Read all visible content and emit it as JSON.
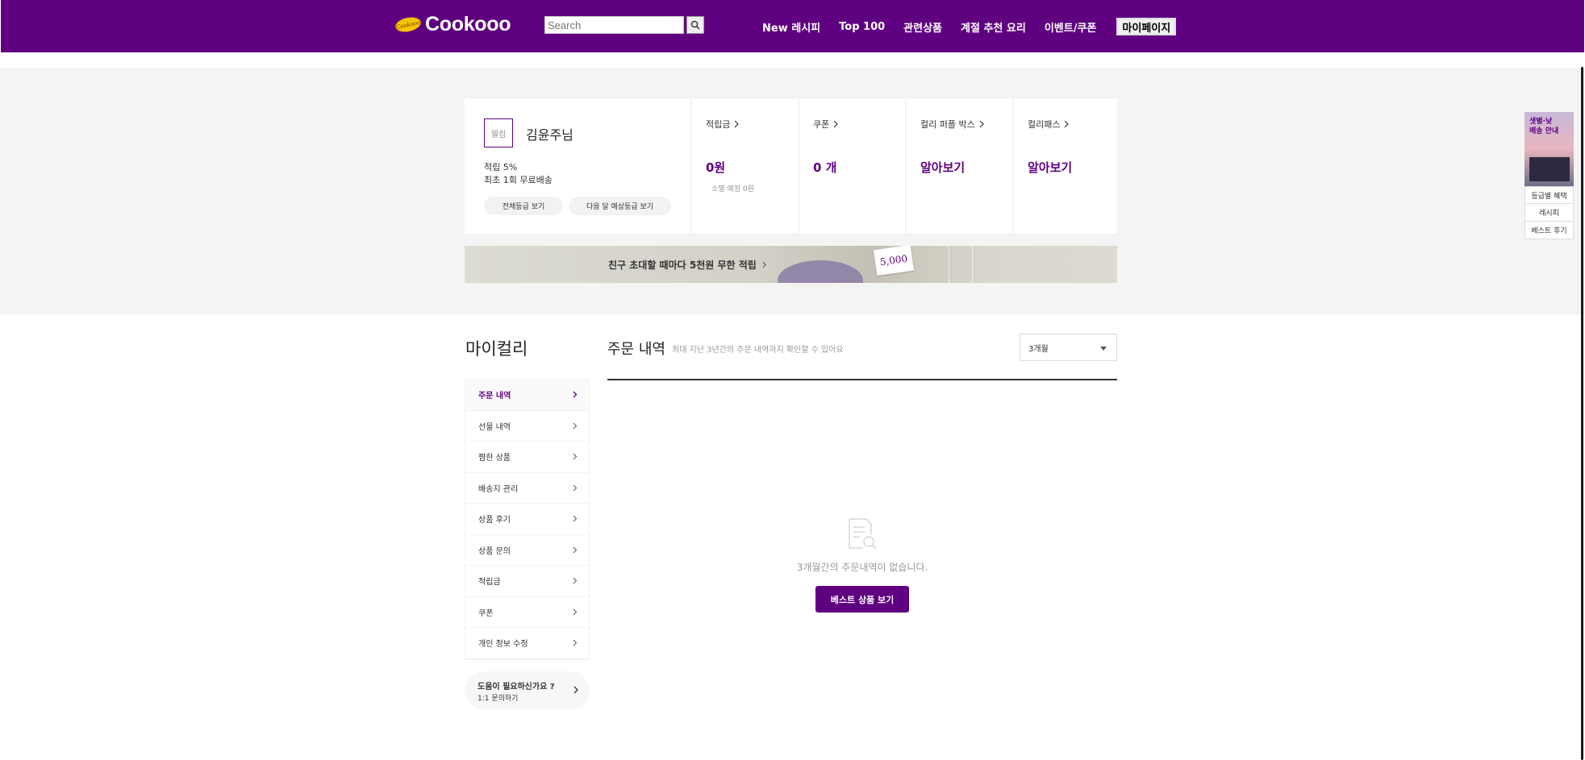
{
  "header": {
    "logo_badge": "Cookooo",
    "logo": "Cookooo",
    "search_placeholder": "Search",
    "nav": [
      "New 레시피",
      "Top 100",
      "관련상품",
      "계절 추천 요리",
      "이벤트/쿠폰"
    ],
    "mypage": "마이페이지"
  },
  "profile": {
    "grade": "웰컴",
    "name": "김윤주님",
    "benefit_rate": "적립 5%",
    "benefit_shipping": "최초 1회 무료배송",
    "btn_all_grades": "전체등급 보기",
    "btn_next_grade": "다음 달 예상등급 보기"
  },
  "stats": [
    {
      "title": "적립금",
      "value": "0원",
      "sub": "소멸 예정 0원"
    },
    {
      "title": "쿠폰",
      "value": "0 개",
      "sub": ""
    },
    {
      "title": "컬리 퍼플 박스",
      "value": "알아보기",
      "sub": ""
    },
    {
      "title": "컬리패스",
      "value": "알아보기",
      "sub": ""
    }
  ],
  "banner": {
    "text": "친구 초대할 때마다 5천원 무한 적립",
    "amount": "5,000"
  },
  "quick_menu": {
    "ad_line1": "샛별·낮",
    "ad_line2": "배송 안내",
    "links": [
      "등급별 혜택",
      "레시피",
      "베스트 후기"
    ]
  },
  "side": {
    "title": "마이컬리",
    "items": [
      "주문 내역",
      "선물 내역",
      "찜한 상품",
      "배송지 관리",
      "상품 후기",
      "상품 문의",
      "적립금",
      "쿠폰",
      "개인 정보 수정"
    ],
    "active_index": 0,
    "help_title": "도움이 필요하신가요 ?",
    "help_sub": "1:1 문의하기"
  },
  "main": {
    "title": "주문 내역",
    "desc": "최대 지난 3년간의 주문 내역까지 확인할 수 있어요",
    "period": "3개월",
    "empty_text": "3개월간의 주문내역이 없습니다.",
    "best_button": "베스트 상품 보기"
  },
  "colors": {
    "brand": "#5f0080",
    "band": "#f4f4f4"
  }
}
